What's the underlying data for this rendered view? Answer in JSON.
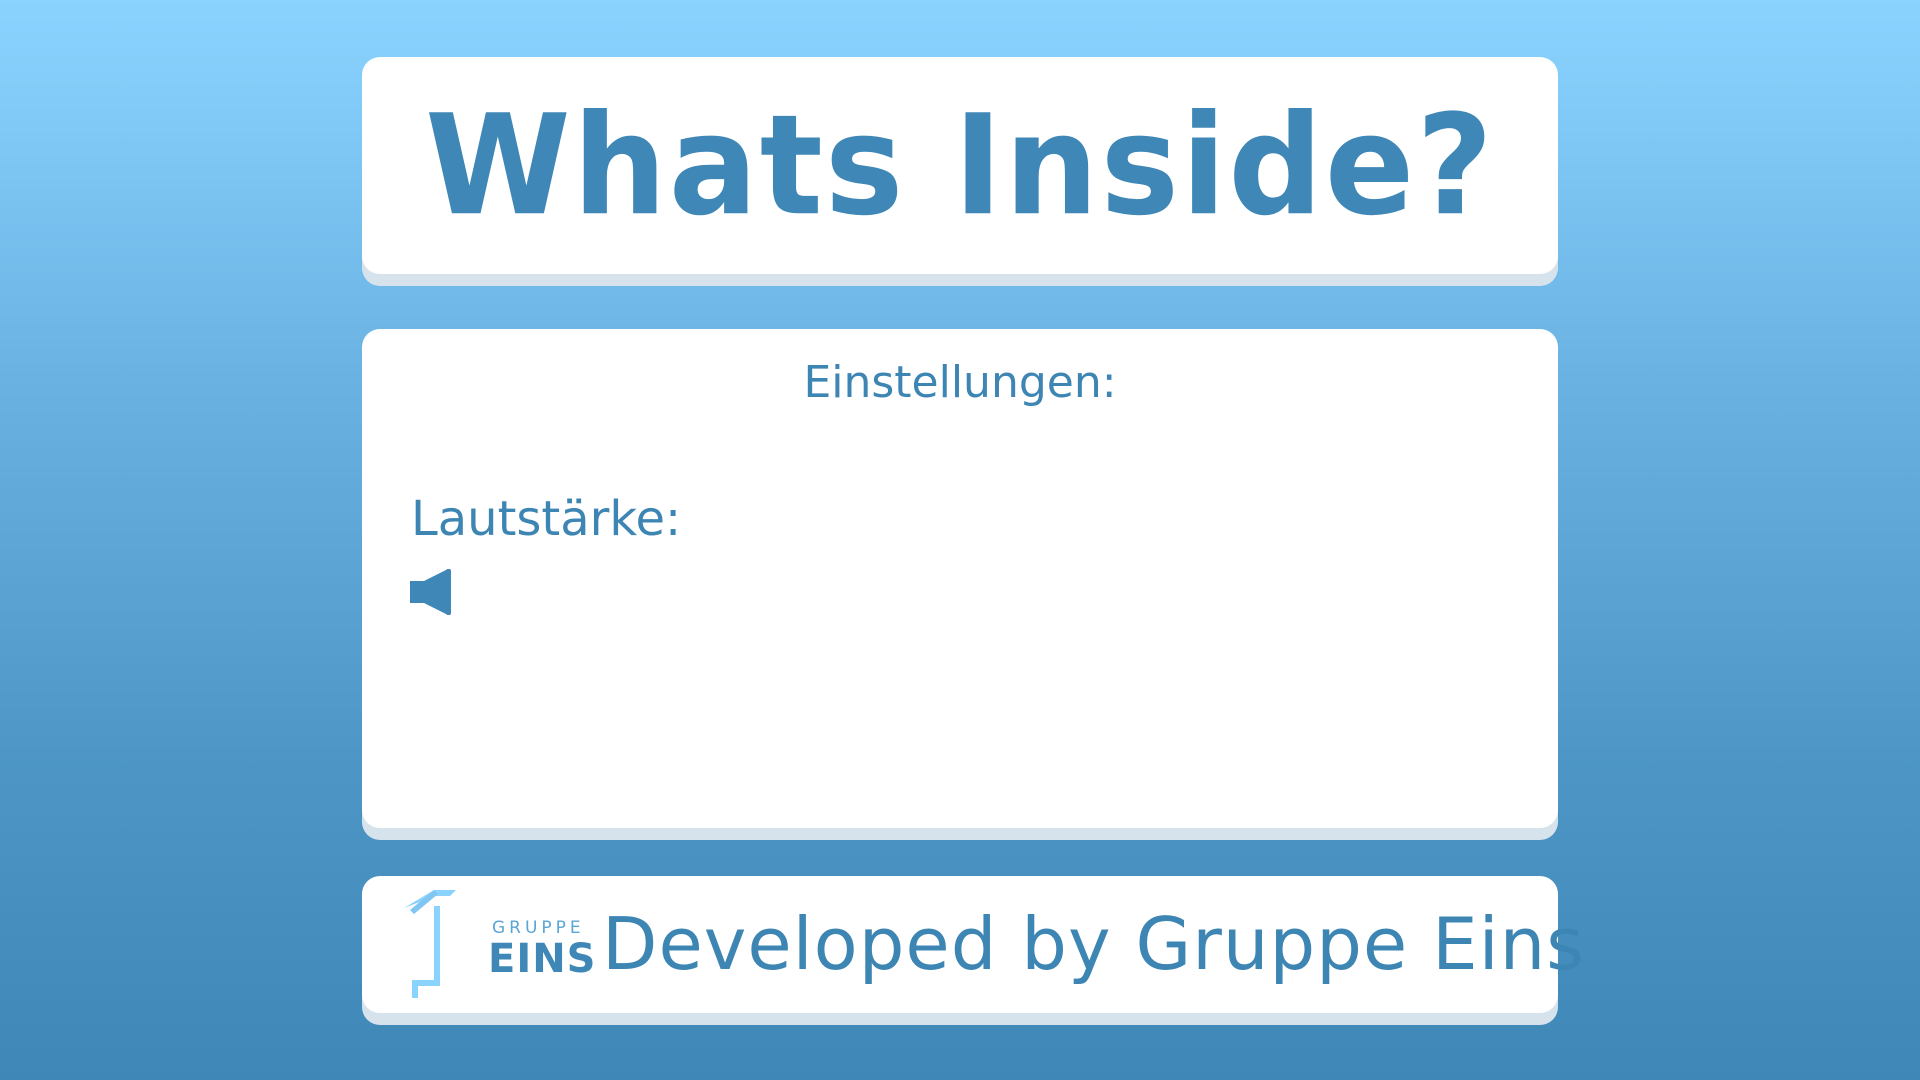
{
  "title": "Whats Inside?",
  "settings": {
    "heading": "Einstellungen:",
    "volume_label": "Lautstärke:",
    "volume_icon": "speaker-icon"
  },
  "footer": {
    "logo_small": "GRUPPE",
    "logo_big": "EINS",
    "text": "Developed by Gruppe Eins"
  },
  "colors": {
    "bg_top": "#8bd3ff",
    "bg_bottom": "#3f87b6",
    "text": "#3d85b3",
    "card": "#ffffff",
    "card_shadow": "#d6e3ec"
  }
}
